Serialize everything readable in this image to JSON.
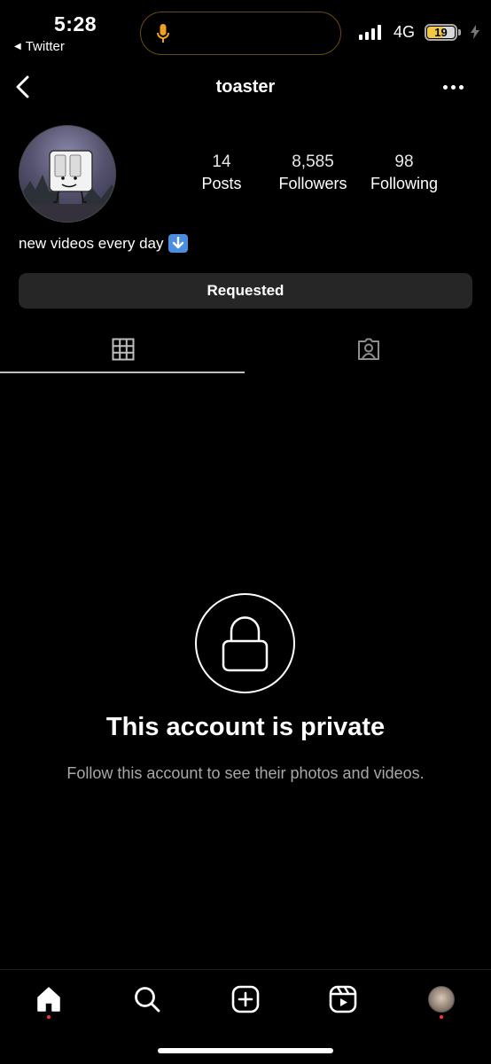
{
  "status_bar": {
    "time": "5:28",
    "back_app": "Twitter",
    "network": "4G",
    "battery": "19",
    "battery_level": 0.19,
    "mic_icon": "mic-icon",
    "battery_color": "#f0c845"
  },
  "header": {
    "username": "toaster",
    "back_icon": "chevron-left-icon",
    "more_icon": "more-horizontal-icon"
  },
  "profile": {
    "stats": [
      {
        "value": "14",
        "label": "Posts"
      },
      {
        "value": "8,585",
        "label": "Followers"
      },
      {
        "value": "98",
        "label": "Following"
      }
    ],
    "bio": "new videos every day",
    "bio_emoji": "down-arrow-emoji",
    "follow_button_label": "Requested"
  },
  "tabs": [
    {
      "name": "grid",
      "icon": "grid-icon",
      "active": true
    },
    {
      "name": "tagged",
      "icon": "tagged-person-icon",
      "active": false
    }
  ],
  "private_notice": {
    "title": "This account is private",
    "subtitle": "Follow this account to see their photos and videos.",
    "icon": "lock-icon"
  },
  "bottom_nav": [
    {
      "name": "home",
      "icon": "home-icon",
      "badge": true
    },
    {
      "name": "search",
      "icon": "search-icon",
      "badge": false
    },
    {
      "name": "create",
      "icon": "plus-square-icon",
      "badge": false
    },
    {
      "name": "reels",
      "icon": "reels-icon",
      "badge": false
    },
    {
      "name": "profile",
      "icon": "avatar",
      "badge": true
    }
  ],
  "accent_colors": {
    "badge": "#ff3040",
    "button_bg": "#262626",
    "subtext": "#a8a8a8"
  }
}
